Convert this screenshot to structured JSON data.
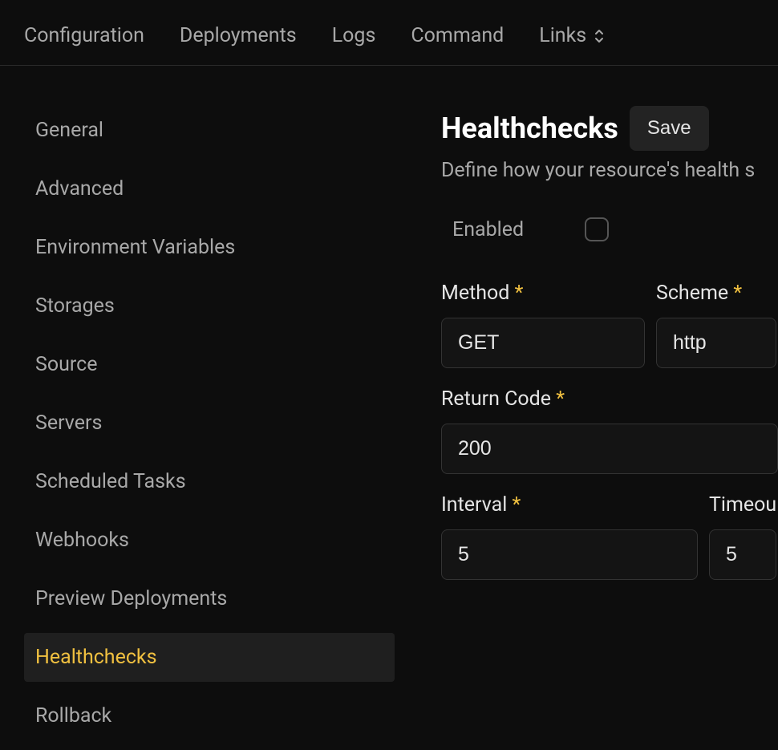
{
  "tabs": {
    "items": [
      {
        "label": "Configuration"
      },
      {
        "label": "Deployments"
      },
      {
        "label": "Logs"
      },
      {
        "label": "Command"
      },
      {
        "label": "Links",
        "hasChevron": true
      }
    ]
  },
  "sidebar": {
    "items": [
      {
        "label": "General",
        "active": false
      },
      {
        "label": "Advanced",
        "active": false
      },
      {
        "label": "Environment Variables",
        "active": false
      },
      {
        "label": "Storages",
        "active": false
      },
      {
        "label": "Source",
        "active": false
      },
      {
        "label": "Servers",
        "active": false
      },
      {
        "label": "Scheduled Tasks",
        "active": false
      },
      {
        "label": "Webhooks",
        "active": false
      },
      {
        "label": "Preview Deployments",
        "active": false
      },
      {
        "label": "Healthchecks",
        "active": true
      },
      {
        "label": "Rollback",
        "active": false
      }
    ]
  },
  "main": {
    "title": "Healthchecks",
    "save_label": "Save",
    "subtitle": "Define how your resource's health s",
    "enabled_label": "Enabled",
    "fields": {
      "method": {
        "label": "Method",
        "required": "*",
        "value": "GET"
      },
      "scheme": {
        "label": "Scheme",
        "required": "*",
        "value": "http"
      },
      "return_code": {
        "label": "Return Code",
        "required": "*",
        "value": "200"
      },
      "interval": {
        "label": "Interval",
        "required": "*",
        "value": "5"
      },
      "timeout": {
        "label": "Timeou",
        "value": "5"
      }
    }
  }
}
